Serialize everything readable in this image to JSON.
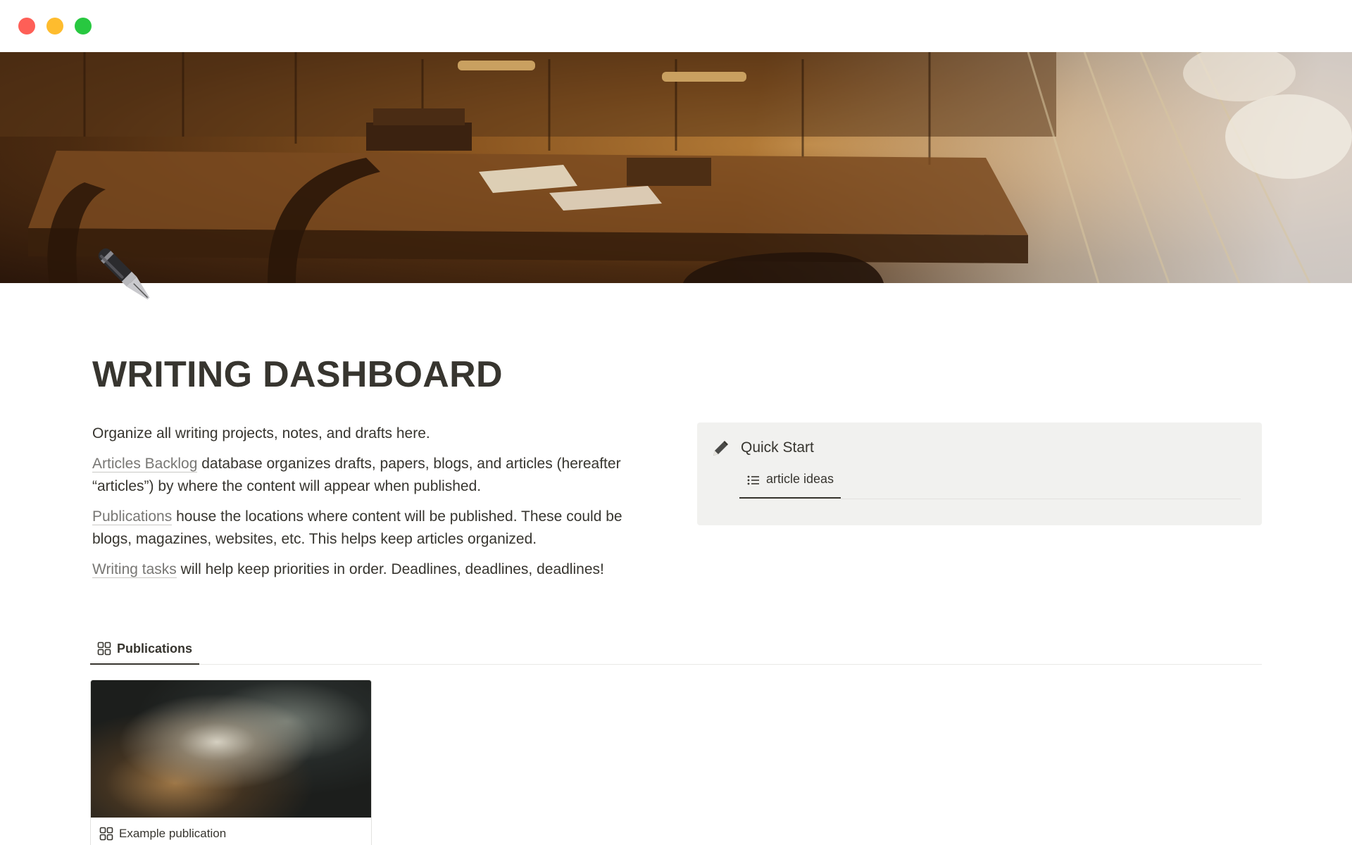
{
  "window": {
    "controls": [
      "close",
      "minimize",
      "zoom"
    ]
  },
  "page": {
    "icon": "fountain-pen-icon",
    "title": "WRITING DASHBOARD"
  },
  "intro": {
    "line1": "Organize all writing projects, notes, and drafts here.",
    "articles_link": "Articles Backlog",
    "articles_text": " database organizes drafts, papers, blogs, and articles (hereafter “articles”) by where the content will appear when published.",
    "publications_link": "Publications",
    "publications_text": " house the locations where content will be published. These could be blogs, magazines, websites, etc. This helps keep articles organized.",
    "tasks_link": "Writing tasks",
    "tasks_text": " will help keep priorities in order. Deadlines, deadlines, deadlines!"
  },
  "quick_start": {
    "icon": "pencil-icon",
    "title": "Quick Start",
    "tab_icon": "list-icon",
    "tab_label": "article ideas"
  },
  "publications": {
    "tab_icon": "gallery-grid-icon",
    "tab_label": "Publications",
    "cards": [
      {
        "title": "Example publication",
        "image": "nebula-photo"
      }
    ]
  },
  "colors": {
    "text": "#37352f",
    "muted_link": "#787774",
    "callout_bg": "#f1f1ef",
    "close": "#fe5f57",
    "minimize": "#febc2e",
    "zoom": "#28c840"
  }
}
